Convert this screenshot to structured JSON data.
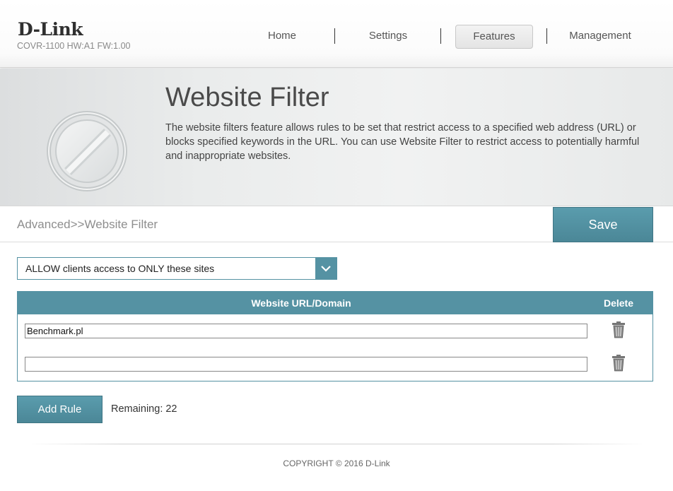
{
  "brand": {
    "logo": "D-Link",
    "model_info": "COVR-1100 HW:A1 FW:1.00"
  },
  "nav": {
    "items": [
      {
        "label": "Home"
      },
      {
        "label": "Settings"
      },
      {
        "label": "Features",
        "active": true
      },
      {
        "label": "Management"
      }
    ]
  },
  "banner": {
    "title": "Website Filter",
    "description": "The website filters feature allows rules to be set that restrict access to a specified web address (URL) or blocks specified keywords in the URL. You can use Website Filter to restrict access to potentially harmful and inappropriate websites.",
    "icon": "prohibited-icon"
  },
  "breadcrumb": "Advanced>>Website Filter",
  "save_label": "Save",
  "filter_mode": {
    "selected": "ALLOW clients access to ONLY these sites",
    "icon": "chevron-down-icon"
  },
  "table": {
    "headers": {
      "url": "Website URL/Domain",
      "delete": "Delete"
    },
    "rows": [
      {
        "url": "Benchmark.pl",
        "delete_icon": "trash-icon"
      },
      {
        "url": "",
        "delete_icon": "trash-icon"
      }
    ]
  },
  "add_rule_label": "Add Rule",
  "remaining": "Remaining: 22",
  "footer": {
    "copyright": "COPYRIGHT © 2016 D-Link"
  },
  "colors": {
    "accent": "#5592a3",
    "button": "#4f8e9f"
  }
}
